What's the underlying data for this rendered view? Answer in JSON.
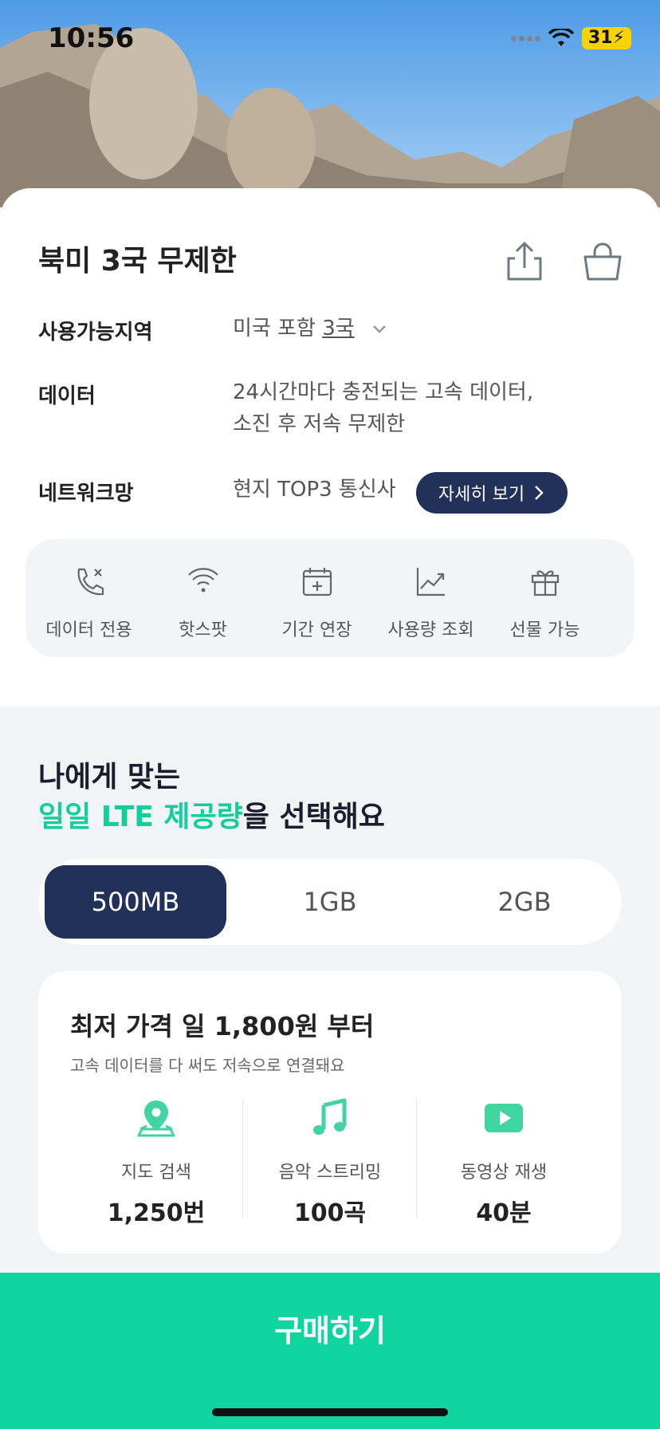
{
  "status_bar": {
    "time": "10:56",
    "battery": "31"
  },
  "product": {
    "title": "북미 3국 무제한",
    "rows": {
      "region_label": "사용가능지역",
      "region_value_prefix": "미국 포함 ",
      "region_value_link": "3국",
      "data_label": "데이터",
      "data_line1": "24시간마다 충전되는 고속 데이터,",
      "data_line2": "소진 후 저속 무제한",
      "network_label": "네트워크망",
      "network_value": "현지 TOP3 통신사",
      "detail_button": "자세히 보기"
    },
    "features": [
      {
        "label": "데이터 전용",
        "icon": "phone-x-icon"
      },
      {
        "label": "핫스팟",
        "icon": "wifi-icon"
      },
      {
        "label": "기간 연장",
        "icon": "calendar-plus-icon"
      },
      {
        "label": "사용량 조회",
        "icon": "chart-icon"
      },
      {
        "label": "선물 가능",
        "icon": "gift-icon"
      }
    ]
  },
  "select_section": {
    "title_line1": "나에게 맞는",
    "title_accent": "일일 LTE 제공량",
    "title_rest": "을 선택해요",
    "options": [
      "500MB",
      "1GB",
      "2GB"
    ],
    "selected": "500MB"
  },
  "price_card": {
    "title": "최저 가격 일 1,800원 부터",
    "subtitle": "고속 데이터를 다 써도 저속으로 연결돼요",
    "stats": [
      {
        "label": "지도 검색",
        "value": "1,250번",
        "icon": "map-pin-icon"
      },
      {
        "label": "음악 스트리밍",
        "value": "100곡",
        "icon": "music-icon"
      },
      {
        "label": "동영상 재생",
        "value": "40분",
        "icon": "video-play-icon"
      }
    ]
  },
  "colors": {
    "accent": "#0fd49e",
    "navy": "#22315a"
  },
  "buy_button": "구매하기"
}
